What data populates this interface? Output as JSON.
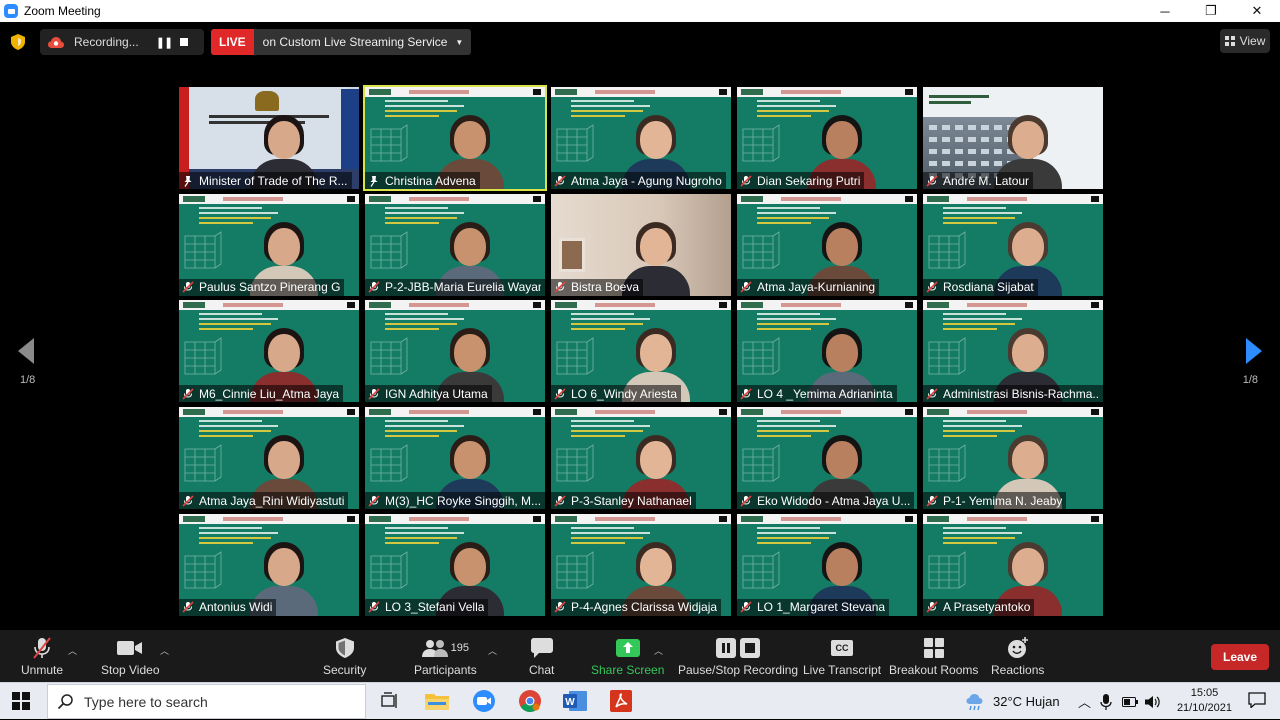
{
  "window": {
    "title": "Zoom Meeting",
    "minimize": "─",
    "maximize": "❐",
    "close": "✕"
  },
  "topbar": {
    "recording_label": "Recording...",
    "live_label": "LIVE",
    "streaming_label": "on Custom Live Streaming Service",
    "view_label": "View"
  },
  "pagination": {
    "left": "1/8",
    "right": "1/8"
  },
  "participants": [
    {
      "name": "Minister of Trade of The R...",
      "muted": false,
      "style": "office"
    },
    {
      "name": "Christina Advena",
      "muted": false,
      "style": "green",
      "active": true
    },
    {
      "name": "Atma Jaya - Agung Nugroho",
      "muted": true,
      "style": "green"
    },
    {
      "name": "Dian Sekaring Putri",
      "muted": true,
      "style": "green"
    },
    {
      "name": "André M. Latour",
      "muted": true,
      "style": "campus"
    },
    {
      "name": "Paulus Santzo Pinerang G",
      "muted": true,
      "style": "green"
    },
    {
      "name": "P-2-JBB-Maria Eurelia Wayan",
      "muted": true,
      "style": "green"
    },
    {
      "name": "Bistra   Boeva",
      "muted": true,
      "style": "beige"
    },
    {
      "name": "Atma Jaya-Kurnianing",
      "muted": true,
      "style": "green"
    },
    {
      "name": "Rosdiana Sijabat",
      "muted": true,
      "style": "green"
    },
    {
      "name": "M6_Cinnie Liu_Atma Jaya",
      "muted": true,
      "style": "green"
    },
    {
      "name": "IGN Adhitya Utama",
      "muted": true,
      "style": "green"
    },
    {
      "name": "LO 6_Windy Ariesta",
      "muted": true,
      "style": "green"
    },
    {
      "name": "LO 4 _Yemima Adrianinta",
      "muted": true,
      "style": "green"
    },
    {
      "name": "Administrasi Bisnis-Rachma...",
      "muted": true,
      "style": "green"
    },
    {
      "name": "Atma Jaya_Rini Widiyastuti",
      "muted": true,
      "style": "green"
    },
    {
      "name": "M(3)_HC Royke Singgih, M...",
      "muted": true,
      "style": "green"
    },
    {
      "name": "P-3-Stanley Nathanael",
      "muted": true,
      "style": "green"
    },
    {
      "name": "Eko Widodo - Atma Jaya U...",
      "muted": true,
      "style": "green"
    },
    {
      "name": "P-1- Yemima N. Jeaby",
      "muted": true,
      "style": "green"
    },
    {
      "name": "Antonius Widi",
      "muted": true,
      "style": "green"
    },
    {
      "name": "LO 3_Stefani Vella",
      "muted": true,
      "style": "green"
    },
    {
      "name": "P-4-Agnes Clarissa Widjaja",
      "muted": true,
      "style": "green"
    },
    {
      "name": "LO 1_Margaret Stevana",
      "muted": true,
      "style": "green"
    },
    {
      "name": "A Prasetyantoko",
      "muted": true,
      "style": "green"
    }
  ],
  "toolbar": {
    "unmute": "Unmute",
    "stop_video": "Stop Video",
    "security": "Security",
    "participants": "Participants",
    "participant_count": "195",
    "chat": "Chat",
    "share_screen": "Share Screen",
    "pause_stop_recording": "Pause/Stop Recording",
    "live_transcript": "Live Transcript",
    "cc_badge": "CC",
    "breakout_rooms": "Breakout Rooms",
    "reactions": "Reactions",
    "leave": "Leave"
  },
  "taskbar": {
    "search_placeholder": "Type here to search",
    "weather": "32°C  Hujan",
    "time": "15:05",
    "date": "21/10/2021"
  },
  "colors": {
    "tile_green": "#147b64",
    "active_outline": "#d9e34a",
    "live_red": "#e02828",
    "leave_red": "#c62828",
    "share_green": "#34c759",
    "mute_red": "#e04343"
  }
}
